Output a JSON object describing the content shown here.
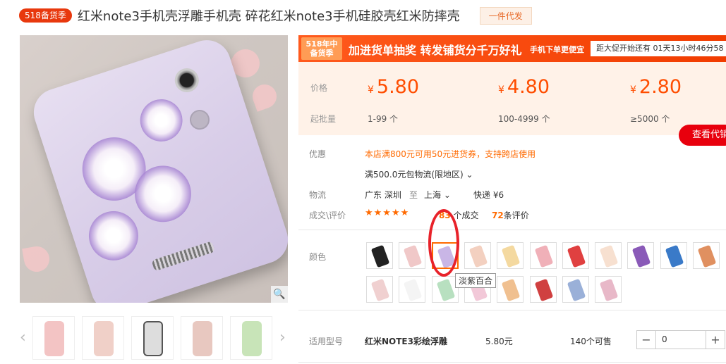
{
  "title": {
    "badge": "518备货季",
    "text": "红米note3手机壳浮雕手机壳 碎花红米note3手机硅胶壳红米防摔壳",
    "one_piece_tag": "一件代发"
  },
  "banner": {
    "badge_line1": "518年中",
    "badge_line2": "备货季",
    "main": "加进货单抽奖 转发铺货分千万好礼",
    "sub": "手机下单更便宜",
    "countdown": "距大促开始还有 01天13小时46分58"
  },
  "pricing": {
    "price_label": "价格",
    "qty_label": "起批量",
    "currency": "¥",
    "tiers": [
      {
        "price": "5.80",
        "qty": "1-99 个"
      },
      {
        "price": "4.80",
        "qty": "100-4999 个"
      },
      {
        "price": "2.80",
        "qty": "≥5000 个"
      }
    ]
  },
  "agent_button": "查看代销",
  "promo": {
    "label": "优惠",
    "line1": "本店满800元可用50元进货券，支持跨店使用",
    "line2": "满500.0元包物流(限地区)"
  },
  "logistics": {
    "label": "物流",
    "from": "广东 深圳",
    "to_word": "至",
    "dest": "上海",
    "express": "快递 ¥6"
  },
  "deals": {
    "label": "成交\\评价",
    "stars": "★★★★★",
    "deal_count": "83",
    "deal_word": "个成交",
    "review_count": "72",
    "review_word": "条评价"
  },
  "color": {
    "label": "颜色",
    "tooltip": "淡紫百合",
    "swatch_colors": [
      "#222",
      "#f0c8c8",
      "#c9b6e6",
      "#f3d0c0",
      "#f4d9a0",
      "#f0b0b8",
      "#e04040",
      "#f7e0d0",
      "#8a5ab8",
      "#3a7ac8",
      "#e09060",
      "#f0d0d0",
      "#f4f4f4",
      "#b8e0c0",
      "#f2c8d8",
      "#f0c090",
      "#d04040",
      "#9ab0d8",
      "#e8b8c8"
    ],
    "selected_index": 2
  },
  "model_row": {
    "label": "适用型号",
    "name": "红米NOTE3彩绘浮雕",
    "price": "5.80元",
    "stock": "140个可售",
    "quantity": "0"
  }
}
